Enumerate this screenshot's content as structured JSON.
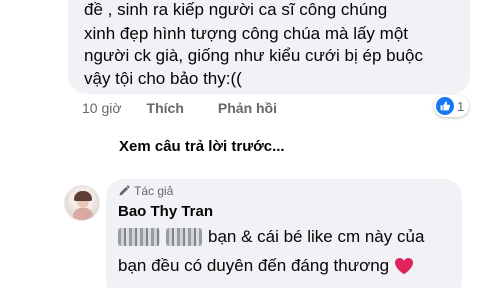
{
  "comment": {
    "lines": [
      "đề , sinh ra kiếp người ca sĩ công chúng",
      "xinh đẹp hình tượng công chúa mà lấy một",
      "người ck già, giống như kiểu cưới bị ép buộc",
      "vậy tội cho bảo thy:(("
    ],
    "time": "10 giờ",
    "like_label": "Thích",
    "reply_label": "Phản hồi",
    "reaction_count": "1",
    "reaction_color": "#1877f2"
  },
  "view_previous_replies": "Xem câu trả lời trước...",
  "reply": {
    "author_badge": "Tác giả",
    "author_name": "Bao Thy Tran",
    "line1_text": "bạn & cái bé like cm này của",
    "line2_text": "bạn đều có duyên đến đáng thương",
    "heart_color": "#e0245e"
  }
}
